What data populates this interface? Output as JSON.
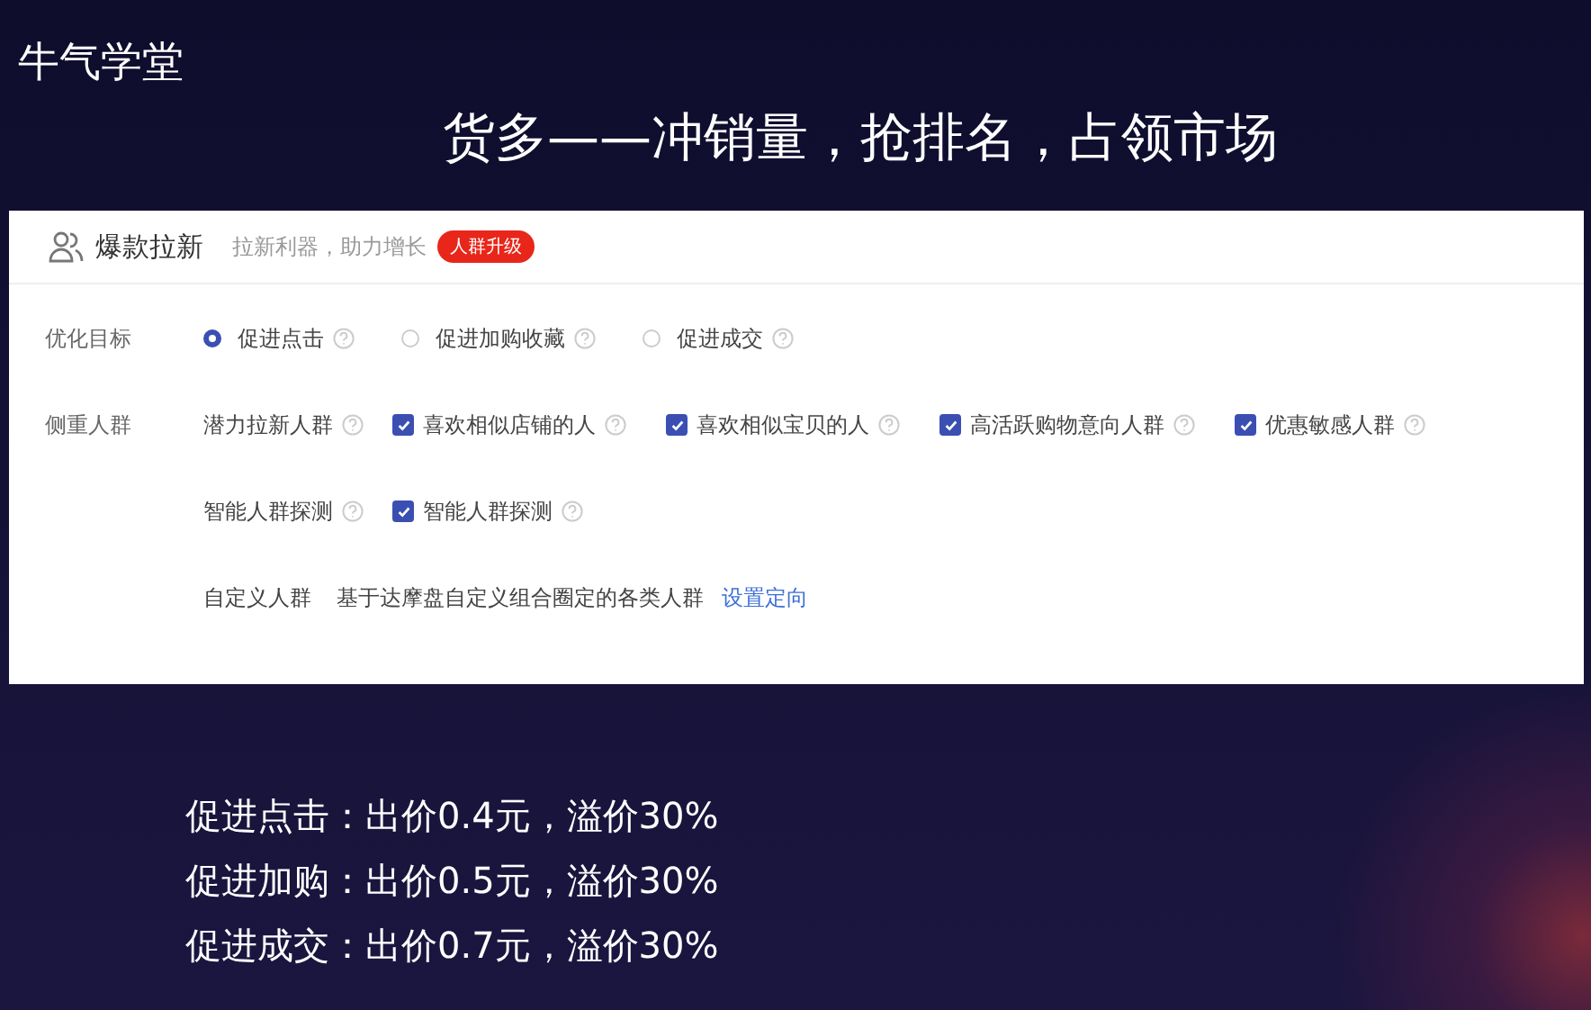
{
  "logo": {
    "text": "牛气学堂"
  },
  "slide_title": "货多——冲销量，抢排名，占领市场",
  "panel": {
    "title": "爆款拉新",
    "subtitle": "拉新利器，助力增长",
    "badge": "人群升级",
    "goal": {
      "label": "优化目标",
      "options": [
        {
          "label": "促进点击",
          "selected": true
        },
        {
          "label": "促进加购收藏",
          "selected": false
        },
        {
          "label": "促进成交",
          "selected": false
        }
      ]
    },
    "audience": {
      "label": "侧重人群",
      "groups": [
        {
          "label": "潜力拉新人群",
          "options": [
            {
              "label": "喜欢相似店铺的人",
              "checked": true
            },
            {
              "label": "喜欢相似宝贝的人",
              "checked": true
            },
            {
              "label": "高活跃购物意向人群",
              "checked": true
            },
            {
              "label": "优惠敏感人群",
              "checked": true
            }
          ]
        },
        {
          "label": "智能人群探测",
          "options": [
            {
              "label": "智能人群探测",
              "checked": true
            }
          ]
        }
      ],
      "custom": {
        "label": "自定义人群",
        "description": "基于达摩盘自定义组合圈定的各类人群",
        "link": "设置定向"
      }
    }
  },
  "notes": [
    "促进点击：出价0.4元，溢价30%",
    "促进加购：出价0.5元，溢价30%",
    "促进成交：出价0.7元，溢价30%"
  ]
}
